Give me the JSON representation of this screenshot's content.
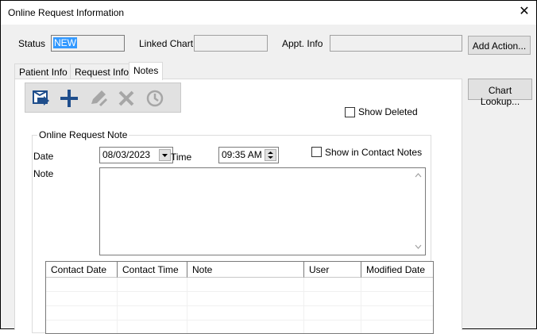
{
  "window": {
    "title": "Online Request Information",
    "close_glyph": "✕"
  },
  "header": {
    "status_label": "Status",
    "status_value": "NEW",
    "linked_chart_label": "Linked Chart",
    "linked_chart_value": "",
    "appt_info_label": "Appt. Info",
    "appt_info_value": "",
    "add_action_label": "Add Action...",
    "chart_lookup_label": "Chart Lookup..."
  },
  "tabs": [
    {
      "label": "Patient Info"
    },
    {
      "label": "Request Info"
    },
    {
      "label": "Notes"
    }
  ],
  "active_tab": "Notes",
  "toolbar": {
    "icons": [
      "open-note-icon",
      "add-icon",
      "edit-icon",
      "delete-icon",
      "history-icon"
    ],
    "accent": "#1f4e8c"
  },
  "show_deleted": {
    "label": "Show Deleted",
    "checked": false
  },
  "note_group": {
    "legend": "Online Request Note",
    "date_label": "Date",
    "date_value": "08/03/2023",
    "time_label": "Time",
    "time_value": "09:35 AM",
    "show_in_contact_label": "Show in Contact Notes",
    "show_in_contact_checked": false,
    "note_label": "Note",
    "note_value": ""
  },
  "grid": {
    "columns": [
      "Contact Date",
      "Contact Time",
      "Note",
      "User",
      "Modified Date"
    ],
    "rows": []
  },
  "colors": {
    "selection": "#3399ff",
    "window_bg": "#f0f0f0",
    "button_bg": "#e1e1e1"
  }
}
